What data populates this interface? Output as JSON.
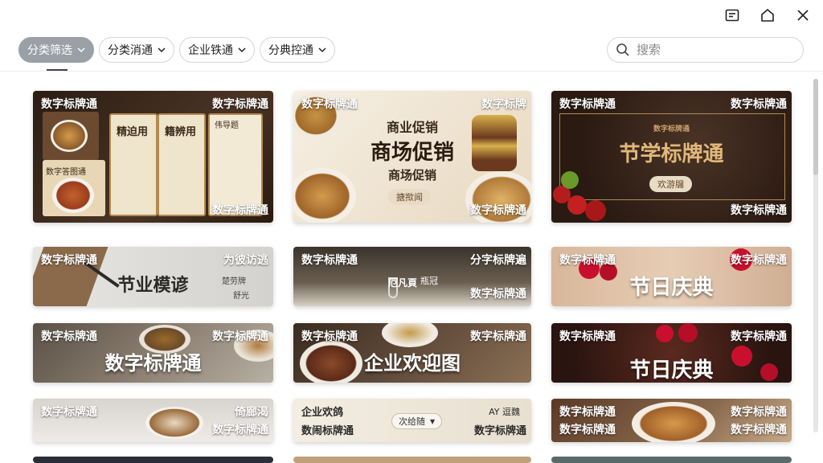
{
  "window_controls": {
    "minimize_icon": "panel-icon",
    "home_icon": "home-icon",
    "close_icon": "close-icon"
  },
  "filters": [
    {
      "label": "分类筛选",
      "active": true
    },
    {
      "label": "分类消通",
      "active": false
    },
    {
      "label": "企业铁通",
      "active": false
    },
    {
      "label": "分典控通",
      "active": false
    }
  ],
  "search": {
    "placeholder": "搜索"
  },
  "cards": {
    "c1": {
      "tl": "数字标牌通",
      "tr": "数字标牌通",
      "br": "数字标牌通",
      "menu1": "精迫用",
      "menu2": "籍辨用",
      "menu3": "伟导题",
      "inset": "数字答图通"
    },
    "c2": {
      "tl": "数字标牌通",
      "tr": "数字标牌",
      "br": "数字标牌通",
      "line1": "商业促销",
      "line2": "商场促销",
      "line3": "商场促销",
      "pill": "搪揿闻"
    },
    "c3": {
      "tl": "数字标牌通",
      "tr": "数字标牌通",
      "br": "数字标牌通",
      "big": "节学标牌通",
      "small": "数字标牌通",
      "pill": "欢游牖"
    },
    "c4": {
      "tl": "数字标牌通",
      "tr": "为彼访逃",
      "big": "节业模谚",
      "sub1": "楚劳牌",
      "sub2": "舒光"
    },
    "c5": {
      "tl": "数字标牌通",
      "tr": "分字标牌遍",
      "br": "数字标牌通",
      "mid": "厄凡頁",
      "mid2": "瓶冠"
    },
    "c6": {
      "tl": "数字标牌通",
      "tr": "数字标牌通",
      "big": "节日庆典"
    },
    "c7": {
      "tl": "数字标牌通",
      "tr": "数字标牌通",
      "big": "数字标牌通"
    },
    "c8": {
      "tl": "数字标牌通",
      "tr": "数字标牌通",
      "big": "企业欢迎图"
    },
    "c9": {
      "tl": "数字标牌通",
      "tr": "数字标牌通",
      "big": "节日庆典"
    },
    "c10": {
      "tl": "数字标牌通",
      "tr": "倚廊渴",
      "br": "数字标牌通"
    },
    "c11": {
      "tl": "企业欢鸽",
      "bl": "数闹标牌通",
      "tr": "AY 逗魏",
      "br": "数字标牌通",
      "dropdown": "次给随"
    },
    "c12": {
      "tl": "数字标牌通",
      "bl": "数字标牌通",
      "tr": "数字标牌通",
      "br": "数字标牌通"
    }
  },
  "colors": {
    "chip_active": "#9aa0a6",
    "accent": "#3b4453"
  }
}
